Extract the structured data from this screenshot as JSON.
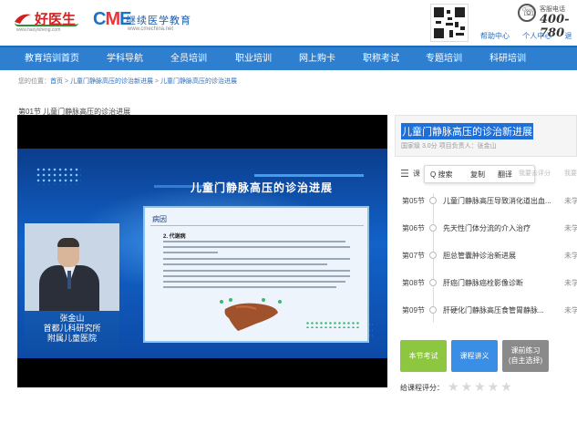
{
  "header": {
    "logo1_name": "好医生",
    "logo1_url": "www.haoyisheng.com",
    "logo2_cme": [
      "C",
      "M",
      "E"
    ],
    "logo2_title": "继续医学教育",
    "logo2_sub": "www.cmechina.net",
    "links": [
      "帮助中心",
      "个人中心",
      "退"
    ],
    "phone_label": "客服电话",
    "phone_number": "400-780"
  },
  "nav": {
    "items": [
      "教育培训首页",
      "学科导航",
      "全员培训",
      "职业培训",
      "网上购卡",
      "职称考试",
      "专题培训",
      "科研培训"
    ]
  },
  "breadcrumb": {
    "prefix": "您的位置：",
    "home": "首页",
    "sep": " > ",
    "course": "儿童门静脉高压的诊治新进展",
    "current": "儿童门静脉高压的诊治进展"
  },
  "section_title": "第01节 儿童门静脉高压的诊治进展",
  "video": {
    "slide_title": "儿童门静脉高压的诊治进展",
    "slide_head": "病因",
    "slide_sub": "2. 代谢病",
    "presenter_name": "张金山",
    "presenter_org_line1": "首都儿科研究所",
    "presenter_org_line2": "附属儿童医院"
  },
  "course": {
    "title": "儿童门静脉高压的诊治新进展",
    "meta": "国家级 3.0分 项目负责人：张金山"
  },
  "toolbar": {
    "popup_search": "Q 搜索",
    "popup_copy": "复制",
    "popup_translate": "翻译",
    "eval_hint": "我要去评分",
    "eval_hint2": "我要",
    "list_icon_glyph": "☰",
    "hidden_tab": "课"
  },
  "lessons": [
    {
      "no": "第05节",
      "name": "儿童门静脉高压导致消化道出血...",
      "status": "未学"
    },
    {
      "no": "第06节",
      "name": "先天性门体分流的介入治疗",
      "status": "未学"
    },
    {
      "no": "第07节",
      "name": "胆总管囊肿诊治新进展",
      "status": "未学"
    },
    {
      "no": "第08节",
      "name": "肝癌门静脉癌栓影像诊断",
      "status": "未学"
    },
    {
      "no": "第09节",
      "name": "肝硬化门静脉高压食管胃静脉...",
      "status": "未学"
    }
  ],
  "buttons": {
    "exam": "本节考试",
    "handout": "课程讲义",
    "practice_line1": "课前练习",
    "practice_line2": "(自主选择)"
  },
  "rating": {
    "label": "给课程评分：",
    "stars": "★★★★★",
    "value": 0,
    "max": 5
  },
  "colors": {
    "nav_bg": "#2f7fd1",
    "title_highlight": "#1e6fd9",
    "btn_exam": "#8dc63f",
    "btn_handout": "#3a8ee6",
    "btn_practice": "#8a8a8a"
  }
}
